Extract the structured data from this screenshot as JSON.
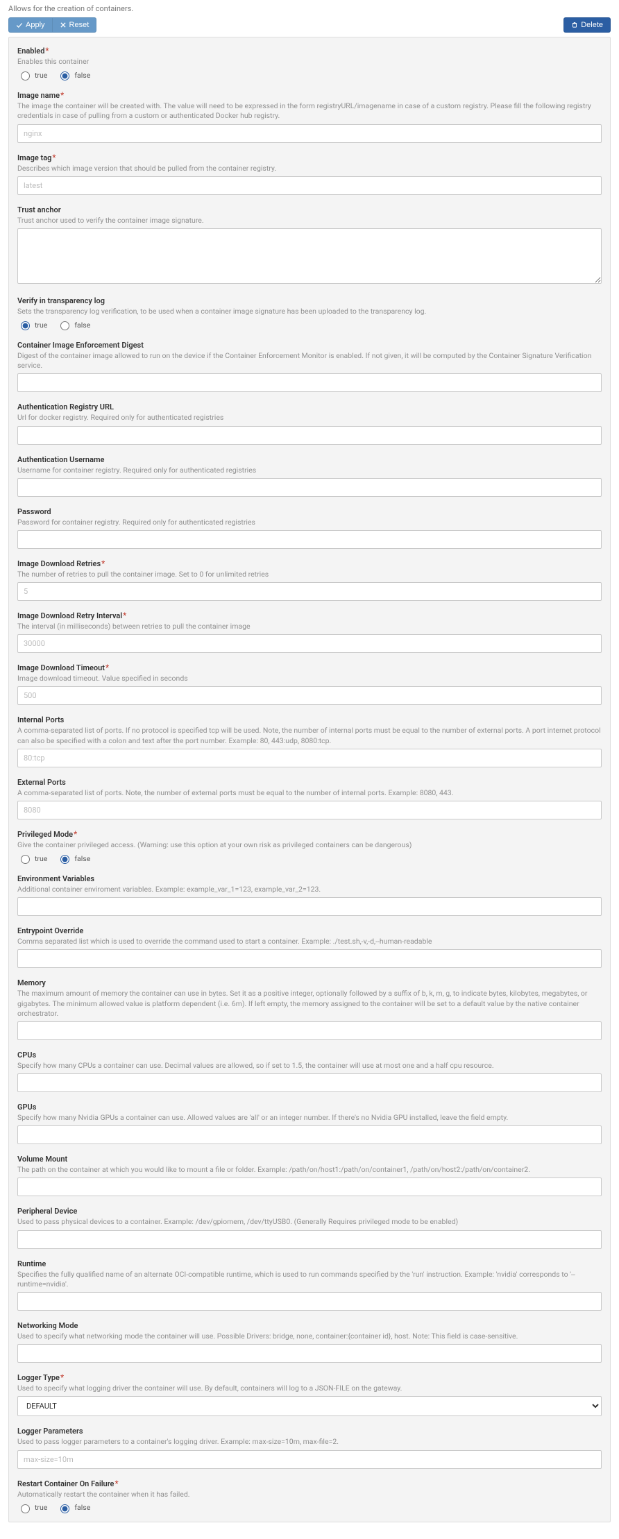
{
  "intro": "Allows for the creation of containers.",
  "toolbar": {
    "apply": "Apply",
    "reset": "Reset",
    "delete": "Delete"
  },
  "radio_labels": {
    "true": "true",
    "false": "false"
  },
  "fields": {
    "enabled": {
      "label": "Enabled",
      "required": true,
      "type": "radio",
      "help": "Enables this container",
      "value": "false"
    },
    "image_name": {
      "label": "Image name",
      "required": true,
      "type": "text",
      "help": "The image the container will be created with. The value will need to be expressed in the form registryURL/imagename in case of a custom registry. Please fill the following registry credentials in case of pulling from a custom or authenticated Docker hub registry.",
      "placeholder": "nginx"
    },
    "image_tag": {
      "label": "Image tag",
      "required": true,
      "type": "text",
      "help": "Describes which image version that should be pulled from the container registry.",
      "placeholder": "latest"
    },
    "trust_anchor": {
      "label": "Trust anchor",
      "required": false,
      "type": "textarea",
      "help": "Trust anchor used to verify the container image signature."
    },
    "verify_tlog": {
      "label": "Verify in transparency log",
      "required": false,
      "type": "radio",
      "help": "Sets the transparency log verification, to be used when a container image signature has been uploaded to the transparency log.",
      "value": "true"
    },
    "enf_digest": {
      "label": "Container Image Enforcement Digest",
      "required": false,
      "type": "text",
      "help": "Digest of the container image allowed to run on the device if the Container Enforcement Monitor is enabled. If not given, it will be computed by the Container Signature Verification service."
    },
    "auth_url": {
      "label": "Authentication Registry URL",
      "required": false,
      "type": "text",
      "help": "Url for docker registry. Required only for authenticated registries"
    },
    "auth_user": {
      "label": "Authentication Username",
      "required": false,
      "type": "text",
      "help": "Username for container registry. Required only for authenticated registries"
    },
    "password": {
      "label": "Password",
      "required": false,
      "type": "password",
      "help": "Password for container registry. Required only for authenticated registries"
    },
    "dl_retries": {
      "label": "Image Download Retries",
      "required": true,
      "type": "text",
      "help": "The number of retries to pull the container image. Set to 0 for unlimited retries",
      "placeholder": "5"
    },
    "dl_interval": {
      "label": "Image Download Retry Interval",
      "required": true,
      "type": "text",
      "help": "The interval (in milliseconds) between retries to pull the container image",
      "placeholder": "30000"
    },
    "dl_timeout": {
      "label": "Image Download Timeout",
      "required": true,
      "type": "text",
      "help": "Image download timeout. Value specified in seconds",
      "placeholder": "500"
    },
    "internal_ports": {
      "label": "Internal Ports",
      "required": false,
      "type": "text",
      "help": "A comma-separated list of ports. If no protocol is specified tcp will be used. Note, the number of internal ports must be equal to the number of external ports. A port internet protocol can also be specified with a colon and text after the port number. Example: 80, 443:udp, 8080:tcp.",
      "placeholder": "80:tcp"
    },
    "external_ports": {
      "label": "External Ports",
      "required": false,
      "type": "text",
      "help": "A comma-separated list of ports. Note, the number of external ports must be equal to the number of internal ports. Example: 8080, 443.",
      "placeholder": "8080"
    },
    "privileged": {
      "label": "Privileged Mode",
      "required": true,
      "type": "radio",
      "help": "Give the container privileged access. (Warning: use this option at your own risk as privileged containers can be dangerous)",
      "value": "false"
    },
    "env_vars": {
      "label": "Environment Variables",
      "required": false,
      "type": "text",
      "help": "Additional container enviroment variables. Example: example_var_1=123, example_var_2=123."
    },
    "entrypoint": {
      "label": "Entrypoint Override",
      "required": false,
      "type": "text",
      "help": "Comma separated list which is used to override the command used to start a container. Example: ./test.sh,-v,-d,--human-readable"
    },
    "memory": {
      "label": "Memory",
      "required": false,
      "type": "text",
      "help": "The maximum amount of memory the container can use in bytes. Set it as a positive integer, optionally followed by a suffix of b, k, m, g, to indicate bytes, kilobytes, megabytes, or gigabytes. The minimum allowed value is platform dependent (i.e. 6m). If left empty, the memory assigned to the container will be set to a default value by the native container orchestrator."
    },
    "cpus": {
      "label": "CPUs",
      "required": false,
      "type": "text",
      "help": "Specify how many CPUs a container can use. Decimal values are allowed, so if set to 1.5, the container will use at most one and a half cpu resource."
    },
    "gpus": {
      "label": "GPUs",
      "required": false,
      "type": "text",
      "help": "Specify how many Nvidia GPUs a container can use. Allowed values are 'all' or an integer number. If there's no Nvidia GPU installed, leave the field empty."
    },
    "volume": {
      "label": "Volume Mount",
      "required": false,
      "type": "text",
      "help": "The path on the container at which you would like to mount a file or folder. Example: /path/on/host1:/path/on/container1, /path/on/host2:/path/on/container2."
    },
    "peripheral": {
      "label": "Peripheral Device",
      "required": false,
      "type": "text",
      "help": "Used to pass physical devices to a container. Example: /dev/gpiomem, /dev/ttyUSB0. (Generally Requires privileged mode to be enabled)"
    },
    "runtime": {
      "label": "Runtime",
      "required": false,
      "type": "text",
      "help": "Specifies the fully qualified name of an alternate OCI-compatible runtime, which is used to run commands specified by the 'run' instruction. Example: 'nvidia' corresponds to '--runtime=nvidia'."
    },
    "networking": {
      "label": "Networking Mode",
      "required": false,
      "type": "text",
      "help": "Used to specify what networking mode the container will use. Possible Drivers: bridge, none, container:{container id}, host. Note: This field is case-sensitive."
    },
    "logger_type": {
      "label": "Logger Type",
      "required": true,
      "type": "select",
      "help": "Used to specify what logging driver the container will use. By default, containers will log to a JSON-FILE on the gateway.",
      "value": "DEFAULT",
      "options": [
        "DEFAULT"
      ]
    },
    "logger_params": {
      "label": "Logger Parameters",
      "required": false,
      "type": "text",
      "help": "Used to pass logger parameters to a container's logging driver. Example: max-size=10m, max-file=2.",
      "placeholder": "max-size=10m"
    },
    "restart_on_fail": {
      "label": "Restart Container On Failure",
      "required": true,
      "type": "radio",
      "help": "Automatically restart the container when it has failed.",
      "value": "false"
    }
  },
  "field_order": [
    "enabled",
    "image_name",
    "image_tag",
    "trust_anchor",
    "verify_tlog",
    "enf_digest",
    "auth_url",
    "auth_user",
    "password",
    "dl_retries",
    "dl_interval",
    "dl_timeout",
    "internal_ports",
    "external_ports",
    "privileged",
    "env_vars",
    "entrypoint",
    "memory",
    "cpus",
    "gpus",
    "volume",
    "peripheral",
    "runtime",
    "networking",
    "logger_type",
    "logger_params",
    "restart_on_fail"
  ]
}
